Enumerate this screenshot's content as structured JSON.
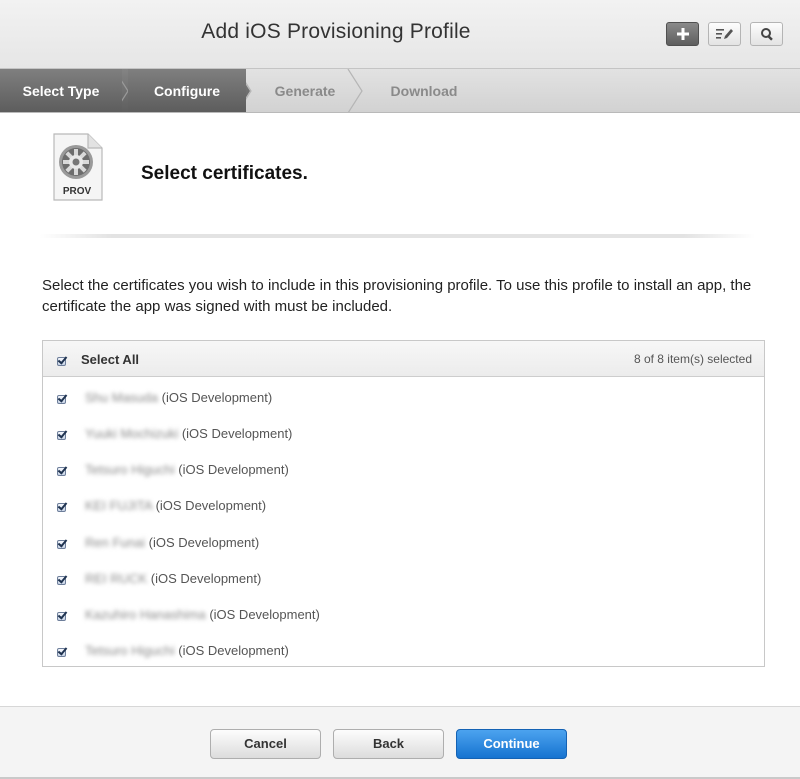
{
  "header": {
    "title": "Add iOS Provisioning Profile",
    "tools": [
      {
        "icon": "plus-icon",
        "active": true
      },
      {
        "icon": "edit-icon",
        "active": false
      },
      {
        "icon": "search-icon",
        "active": false
      }
    ]
  },
  "steps": [
    {
      "label": "Select Type",
      "state": "done"
    },
    {
      "label": "Configure",
      "state": "current"
    },
    {
      "label": "Generate",
      "state": "pending"
    },
    {
      "label": "Download",
      "state": "pending"
    }
  ],
  "profile_icon_label": "PROV",
  "section_title": "Select certificates.",
  "description": "Select the certificates you wish to include in this provisioning profile. To use this profile to install an app, the certificate the app was signed with must be included.",
  "certificates": {
    "select_all_label": "Select All",
    "selected_count": "8 of 8 item(s) selected",
    "items": [
      {
        "name": "Shu Masuda",
        "type": "(iOS Development)",
        "checked": true
      },
      {
        "name": "Yuuki Mochizuki",
        "type": "(iOS Development)",
        "checked": true
      },
      {
        "name": "Tetsuro Higuchi",
        "type": "(iOS Development)",
        "checked": true
      },
      {
        "name": "KEI FUJITA",
        "type": "(iOS Development)",
        "checked": true
      },
      {
        "name": "Ren Funai",
        "type": "(iOS Development)",
        "checked": true
      },
      {
        "name": "REI RUCK",
        "type": "(iOS Development)",
        "checked": true
      },
      {
        "name": "Kazuhiro Hanashima",
        "type": "(iOS Development)",
        "checked": true
      },
      {
        "name": "Tetsuro Higuchi",
        "type": "(iOS Development)",
        "checked": true
      }
    ]
  },
  "footer": {
    "cancel_label": "Cancel",
    "back_label": "Back",
    "continue_label": "Continue"
  },
  "colors": {
    "accent": "#1f7ad9",
    "step_active": "#6b6b6b"
  }
}
